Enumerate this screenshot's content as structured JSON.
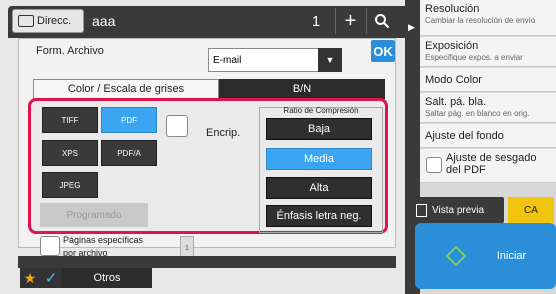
{
  "header": {
    "direc_label": "Direcc.",
    "destination": "aaa",
    "count": "1",
    "plus_symbol": "+",
    "search_icon": "search-icon"
  },
  "dialog": {
    "form_label": "Form. Archivo",
    "format_value": "E-mail",
    "ok_label": "OK",
    "tabs": [
      "Color / Escala de grises",
      "B/N"
    ],
    "file_types": [
      "TIFF",
      "PDF",
      "XPS",
      "PDF/A",
      "JPEG"
    ],
    "selected_type": "PDF",
    "encrip_label": "Encrip.",
    "compression_title": "Ratio de Compresión",
    "compression_options": [
      "Baja",
      "Media",
      "Alta",
      "Énfasis letra neg."
    ],
    "selected_compression": "Media",
    "programado_label": "Programado",
    "pages_label_1": "Páginas específicas",
    "pages_label_2": "por archivo",
    "pages_value": "1"
  },
  "bottom": {
    "otros_label": "Otros"
  },
  "sidebar": {
    "items": [
      {
        "title": "Resolución",
        "sub": "Cambiar la resolución de envío"
      },
      {
        "title": "Exposición",
        "sub": "Especifique expos. a enviar"
      },
      {
        "title": "Modo Color",
        "sub": ""
      },
      {
        "title": "Salt. pá. bla.",
        "sub": "Saltar pág. en blanco en orig."
      },
      {
        "title": "Ajuste del fondo",
        "sub": ""
      },
      {
        "title": "Ajuste de sesgado del PDF",
        "sub": ""
      }
    ],
    "vista_label": "Vista previa",
    "ca_label": "CA",
    "start_label": "Iniciar"
  },
  "colors": {
    "accent": "#3aa6f2",
    "highlight": "#e0134d",
    "start": "#2a8fd8",
    "ca": "#f1c40f"
  }
}
